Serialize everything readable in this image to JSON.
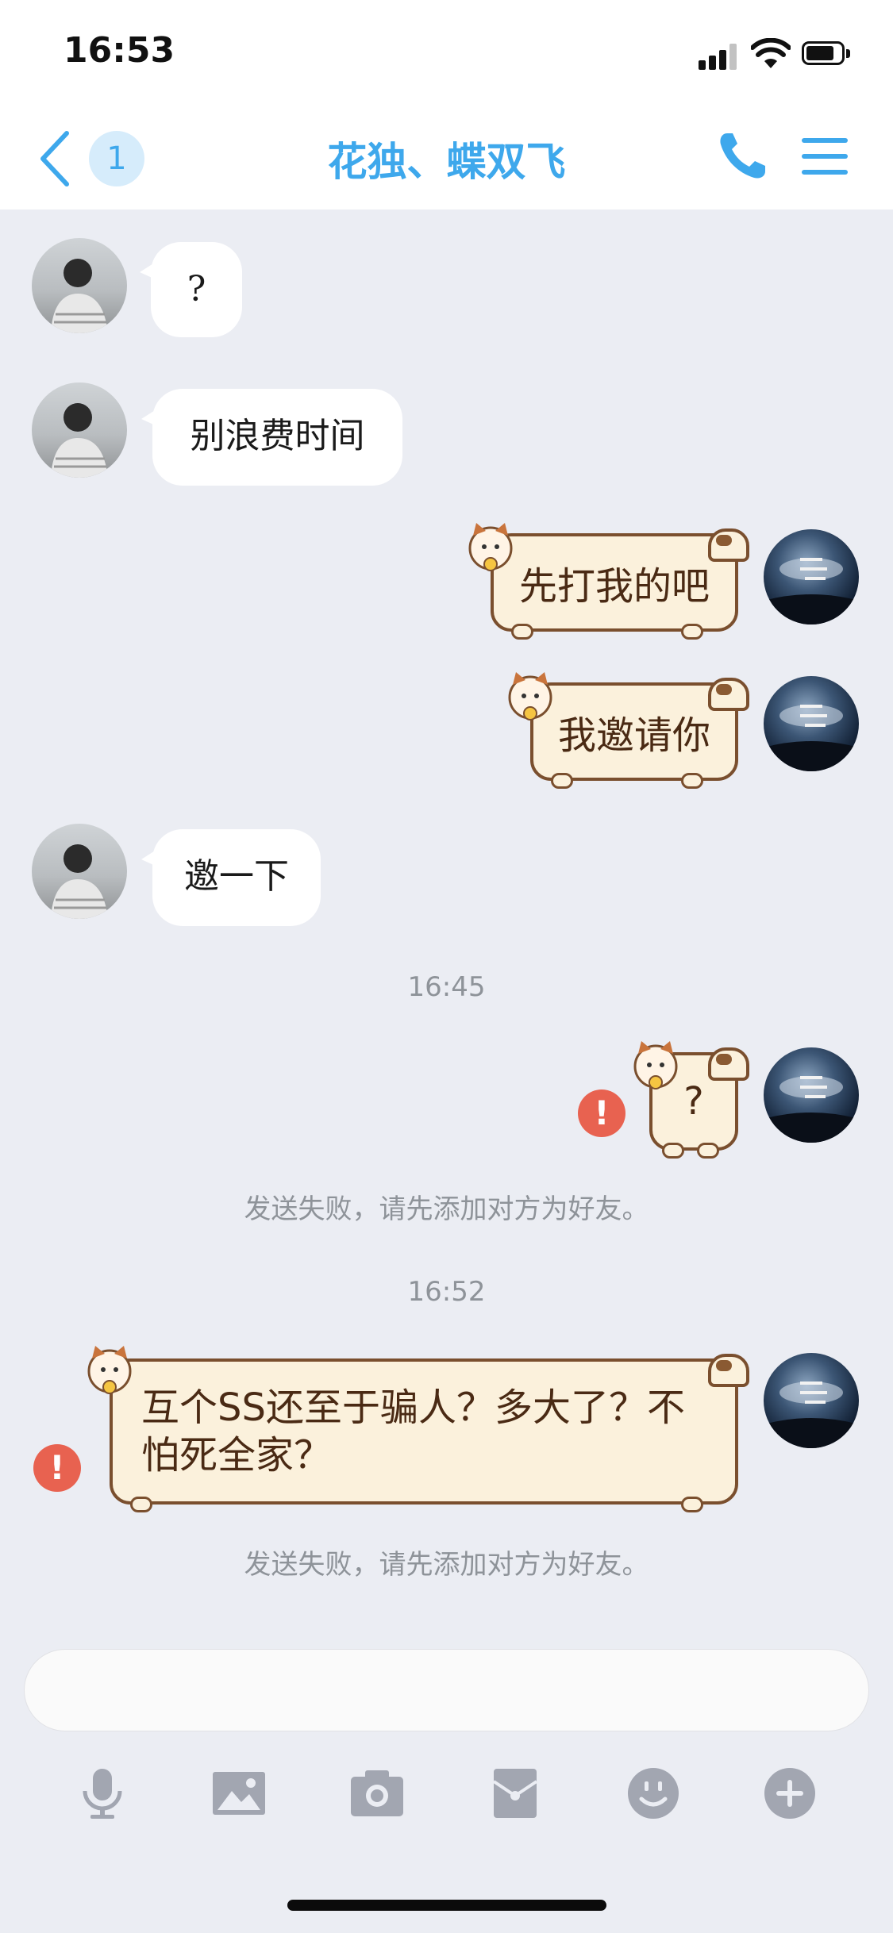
{
  "status_bar": {
    "time": "16:53"
  },
  "header": {
    "unread_count": "1",
    "title": "花独、蝶双飞"
  },
  "messages": [
    {
      "sender": "friend",
      "text": "?"
    },
    {
      "sender": "friend",
      "text": "别浪费时间"
    },
    {
      "sender": "self",
      "text": "先打我的吧"
    },
    {
      "sender": "self",
      "text": "我邀请你"
    },
    {
      "sender": "friend",
      "text": "邀一下"
    },
    {
      "timestamp": "16:45"
    },
    {
      "sender": "self",
      "text": "?",
      "status": "failed"
    },
    {
      "notice": "发送失败，请先添加对方为好友。"
    },
    {
      "timestamp": "16:52"
    },
    {
      "sender": "self",
      "text": "互个SS还至于骗人？多大了？不怕死全家？",
      "status": "failed"
    },
    {
      "notice": "发送失败，请先添加对方为好友。"
    }
  ],
  "error_mark": "!",
  "icons": {
    "back": "chevron-left-icon",
    "call": "phone-icon",
    "menu": "hamburger-menu-icon",
    "toolbar": [
      "microphone-icon",
      "image-icon",
      "camera-icon",
      "red-packet-icon",
      "emoji-icon",
      "plus-icon"
    ]
  },
  "colors": {
    "accent": "#3ea8ec",
    "background": "#ebedf3",
    "error": "#e86250",
    "toolbar_icon": "#a2a6b1"
  }
}
